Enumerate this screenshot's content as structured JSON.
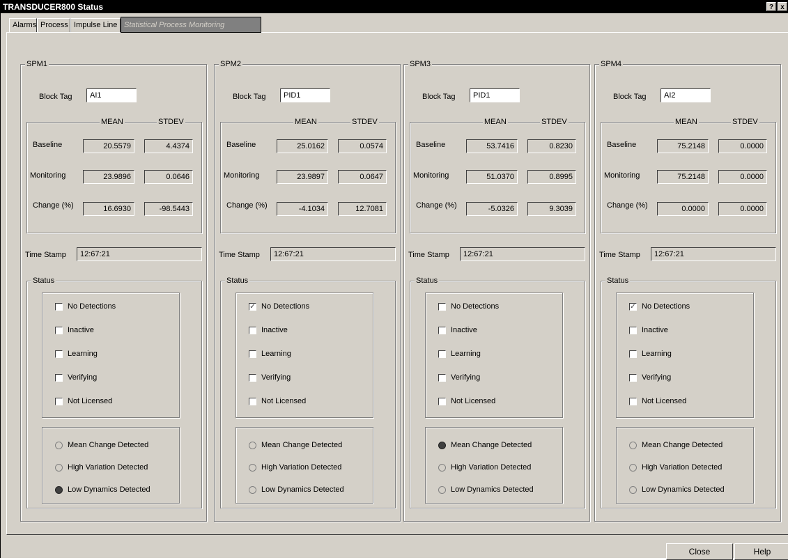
{
  "window": {
    "title": "TRANSDUCER800 Status",
    "help_glyph": "?",
    "close_glyph": "x"
  },
  "tabs": [
    "Alarms",
    "Process",
    "Impulse Line",
    "Statistical Process Monitoring"
  ],
  "labels": {
    "block_tag": "Block Tag",
    "mean": "MEAN",
    "stdev": "STDEV",
    "baseline": "Baseline",
    "monitoring": "Monitoring",
    "change": "Change (%)",
    "time_stamp": "Time Stamp",
    "status": "Status"
  },
  "status_checks": [
    "No Detections",
    "Inactive",
    "Learning",
    "Verifying",
    "Not Licensed"
  ],
  "status_radios": [
    "Mean Change Detected",
    "High Variation Detected",
    "Low Dynamics Detected"
  ],
  "spm": [
    {
      "name": "SPM1",
      "block_tag": "AI1",
      "baseline_mean": "20.5579",
      "baseline_stdev": "4.4374",
      "monitoring_mean": "23.9896",
      "monitoring_stdev": "0.0646",
      "change_mean": "16.6930",
      "change_stdev": "-98.5443",
      "time_stamp": "12:67:21",
      "checked": [
        false,
        false,
        false,
        false,
        false
      ],
      "radios": [
        false,
        false,
        true
      ]
    },
    {
      "name": "SPM2",
      "block_tag": "PID1",
      "baseline_mean": "25.0162",
      "baseline_stdev": "0.0574",
      "monitoring_mean": "23.9897",
      "monitoring_stdev": "0.0647",
      "change_mean": "-4.1034",
      "change_stdev": "12.7081",
      "time_stamp": "12:67:21",
      "checked": [
        true,
        false,
        false,
        false,
        false
      ],
      "radios": [
        false,
        false,
        false
      ]
    },
    {
      "name": "SPM3",
      "block_tag": "PID1",
      "baseline_mean": "53.7416",
      "baseline_stdev": "0.8230",
      "monitoring_mean": "51.0370",
      "monitoring_stdev": "0.8995",
      "change_mean": "-5.0326",
      "change_stdev": "9.3039",
      "time_stamp": "12:67:21",
      "checked": [
        false,
        false,
        false,
        false,
        false
      ],
      "radios": [
        true,
        false,
        false
      ]
    },
    {
      "name": "SPM4",
      "block_tag": "AI2",
      "baseline_mean": "75.2148",
      "baseline_stdev": "0.0000",
      "monitoring_mean": "75.2148",
      "monitoring_stdev": "0.0000",
      "change_mean": "0.0000",
      "change_stdev": "0.0000",
      "time_stamp": "12:67:21",
      "checked": [
        true,
        false,
        false,
        false,
        false
      ],
      "radios": [
        false,
        false,
        false
      ]
    }
  ],
  "buttons": {
    "close": "Close",
    "help": "Help"
  }
}
